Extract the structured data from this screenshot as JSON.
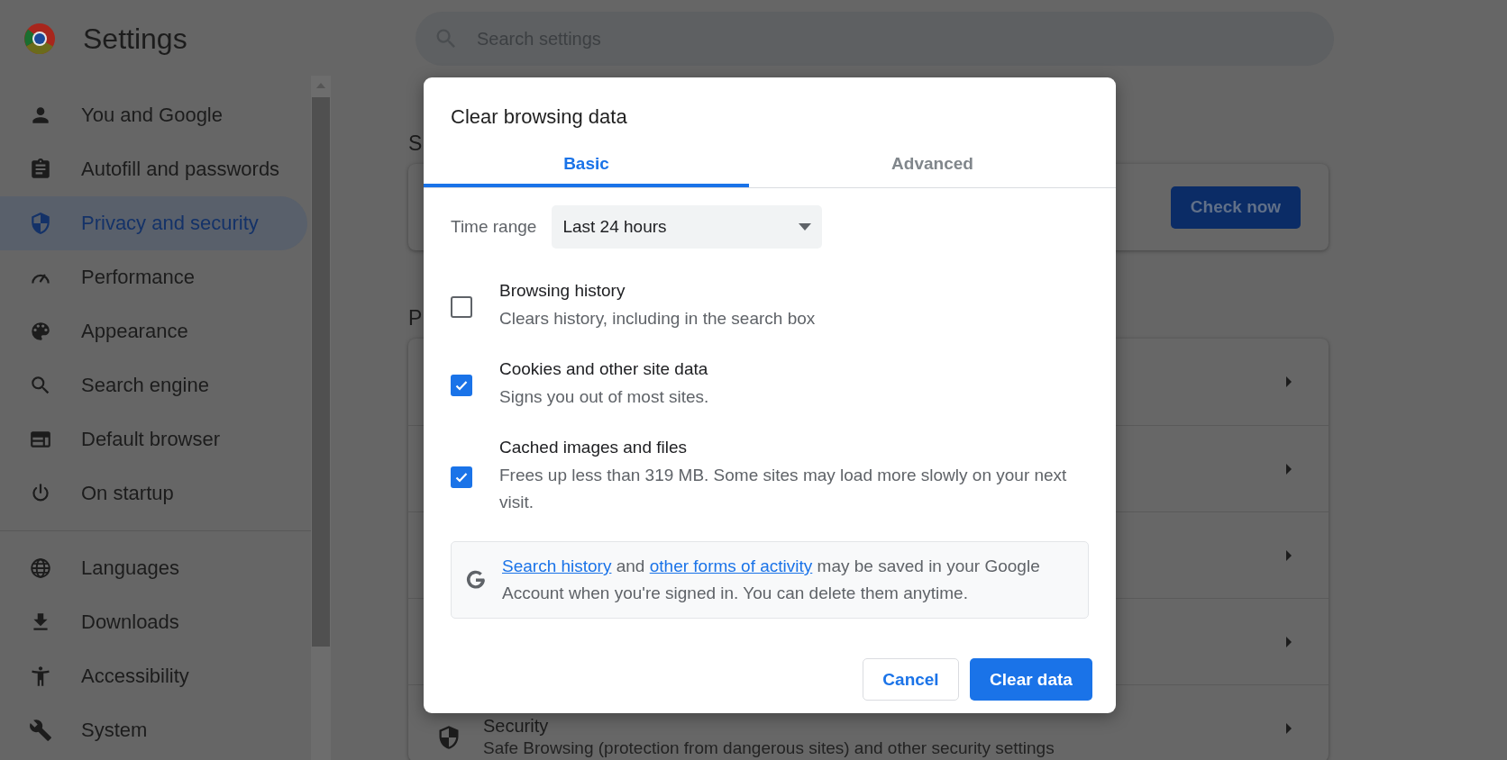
{
  "header": {
    "title": "Settings",
    "search": {
      "placeholder": "Search settings"
    }
  },
  "sidebar": {
    "groups": [
      {
        "items": [
          {
            "label": "You and Google",
            "selected": false
          },
          {
            "label": "Autofill and passwords",
            "selected": false
          },
          {
            "label": "Privacy and security",
            "selected": true
          },
          {
            "label": "Performance",
            "selected": false
          },
          {
            "label": "Appearance",
            "selected": false
          },
          {
            "label": "Search engine",
            "selected": false
          },
          {
            "label": "Default browser",
            "selected": false
          },
          {
            "label": "On startup",
            "selected": false
          }
        ]
      },
      {
        "items": [
          {
            "label": "Languages",
            "selected": false
          },
          {
            "label": "Downloads",
            "selected": false
          },
          {
            "label": "Accessibility",
            "selected": false
          },
          {
            "label": "System",
            "selected": false
          }
        ]
      }
    ]
  },
  "main": {
    "section_1_heading": "S",
    "safety_card": {
      "button": "Check now"
    },
    "section_2_heading": "P",
    "rows": [
      {
        "kind": "covered"
      },
      {
        "kind": "covered"
      },
      {
        "kind": "covered"
      },
      {
        "kind": "covered"
      },
      {
        "kind": "item",
        "title": "Security",
        "subtitle": "Safe Browsing (protection from dangerous sites) and other security settings"
      }
    ]
  },
  "dialog": {
    "title": "Clear browsing data",
    "tabs": [
      {
        "label": "Basic",
        "selected": true
      },
      {
        "label": "Advanced",
        "selected": false
      }
    ],
    "time_range": {
      "label": "Time range",
      "value": "Last 24 hours"
    },
    "options": [
      {
        "title": "Browsing history",
        "description": "Clears history, including in the search box",
        "checked": false
      },
      {
        "title": "Cookies and other site data",
        "description": "Signs you out of most sites.",
        "checked": true
      },
      {
        "title": "Cached images and files",
        "description": "Frees up less than 319 MB. Some sites may load more slowly on your next visit.",
        "checked": true
      }
    ],
    "notice": {
      "segments": [
        {
          "text": "Search history",
          "link": true
        },
        {
          "text": " and ",
          "link": false
        },
        {
          "text": "other forms of activity",
          "link": true
        },
        {
          "text": " may be saved in your Google Account when you're signed in. You can delete them anytime.",
          "link": false
        }
      ]
    },
    "buttons": [
      {
        "label": "Cancel",
        "kind": "secondary"
      },
      {
        "label": "Clear data",
        "kind": "primary"
      }
    ]
  }
}
